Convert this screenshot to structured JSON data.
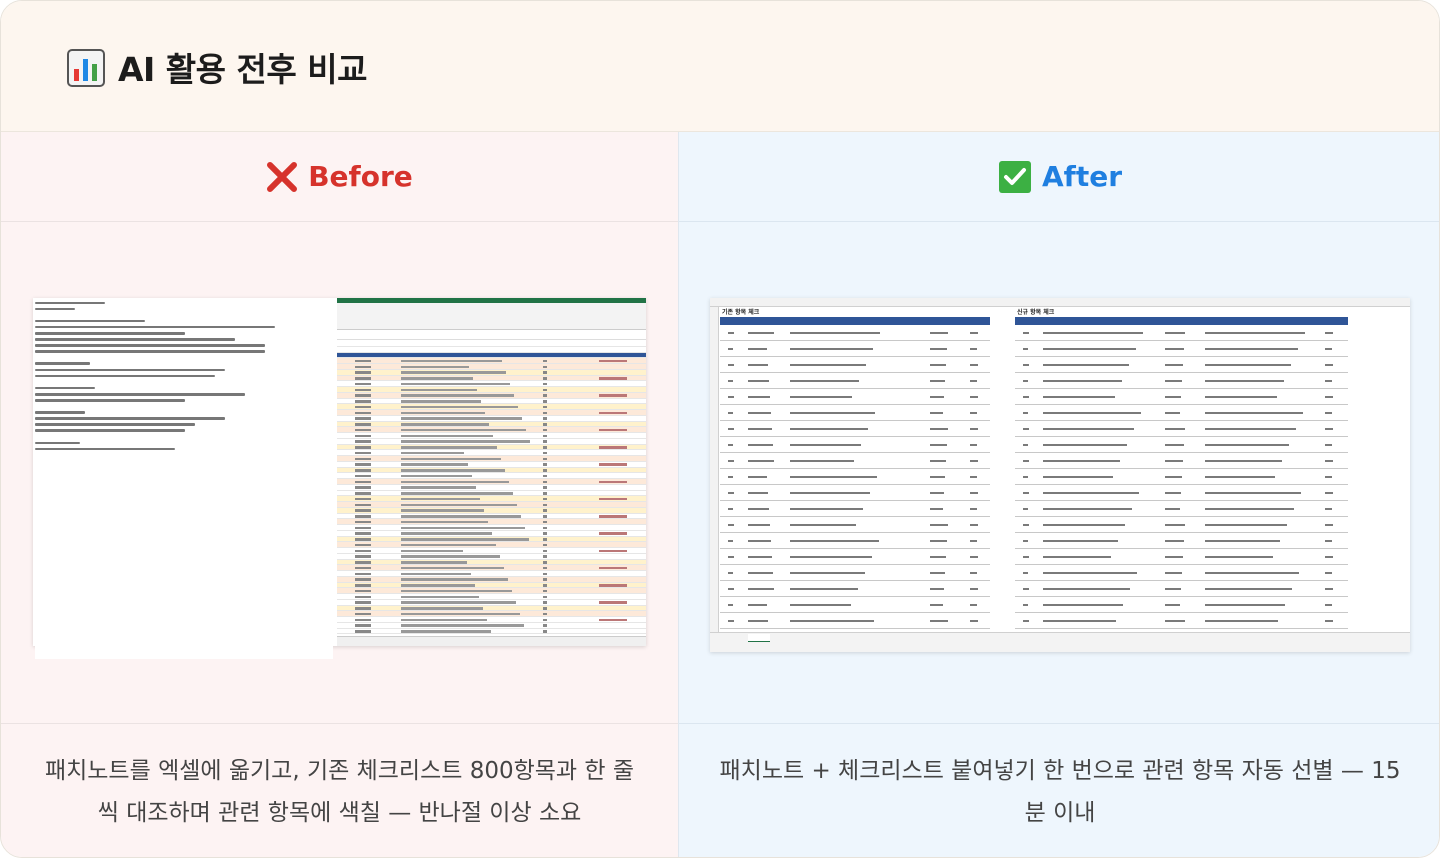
{
  "header": {
    "icon": "bar-chart-icon",
    "title": "AI 활용 전후 비교"
  },
  "before": {
    "icon": "cross-mark-icon",
    "label": "Before",
    "color": "#d6332c",
    "caption": "패치노트를 엑셀에 옮기고, 기존 체크리스트 800항목과 한 줄씩 대조하며 관련 항목에 색칠 — 반나절 이상 소요"
  },
  "after": {
    "icon": "check-mark-icon",
    "label": "After",
    "color": "#1f7fe0",
    "caption": "패치노트 + 체크리스트 붙여넣기 한 번으로 관련 항목 자동 선별 — 15분 이내"
  },
  "after_sheet": {
    "left_title": "기존 항목 체크",
    "right_title": "신규 항목 체크"
  },
  "colors": {
    "before_bg": "#fdf3f3",
    "after_bg": "#eef6fd",
    "header_bg": "#fdf6ef"
  }
}
